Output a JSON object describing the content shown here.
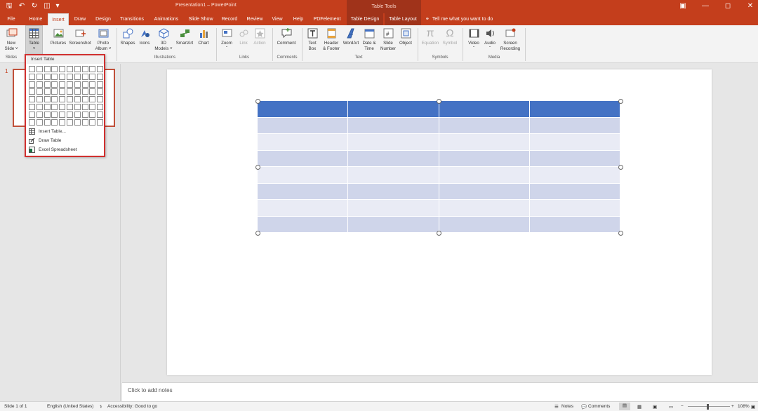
{
  "title_bar": {
    "title": "Presentation1  –  PowerPoint",
    "context_label": "Table Tools",
    "qat_icons": [
      "save-icon",
      "undo-icon",
      "redo-icon",
      "start-from-beginning-icon"
    ]
  },
  "tabs": [
    "File",
    "Home",
    "Insert",
    "Draw",
    "Design",
    "Transitions",
    "Animations",
    "Slide Show",
    "Record",
    "Review",
    "View",
    "Help",
    "PDFelement",
    "Table Design",
    "Table Layout"
  ],
  "active_tab": "Insert",
  "tell_me": "Tell me what you want to do",
  "ribbon": {
    "new_slide": [
      "New",
      "Slide ˅"
    ],
    "table": [
      "Table",
      "˅"
    ],
    "pictures": "Pictures",
    "screenshot": "Screenshot",
    "photo_album": [
      "Photo",
      "Album ˅"
    ],
    "shapes": "Shapes",
    "icons": "Icons",
    "models_3d": [
      "3D",
      "Models ˅"
    ],
    "smartart": "SmartArt",
    "chart": "Chart",
    "zoom": "Zoom",
    "link": "Link",
    "action": "Action",
    "comment": "Comment",
    "text_box": [
      "Text",
      "Box"
    ],
    "header_footer": [
      "Header",
      "& Footer"
    ],
    "wordart": "WordArt",
    "date_time": [
      "Date &",
      "Time"
    ],
    "slide_number": [
      "Slide",
      "Number"
    ],
    "object": "Object",
    "equation": "Equation",
    "symbol": "Symbol",
    "video": "Video",
    "audio": "Audio",
    "screen_recording": [
      "Screen",
      "Recording"
    ],
    "groups": {
      "slides": "Slides",
      "illustrations": "Illustrations",
      "links": "Links",
      "comments": "Comments",
      "text": "Text",
      "symbols": "Symbols",
      "media": "Media"
    }
  },
  "dropdown": {
    "title": "Insert Table",
    "grid_columns": 10,
    "grid_rows": 8,
    "items": [
      "Insert Table...",
      "Draw Table",
      "Excel Spreadsheet"
    ]
  },
  "thumbnail_number": "1",
  "slide_table": {
    "rows": 8,
    "columns": 4,
    "header_color": "#4472c4",
    "band_color_1": "#cfd5ea",
    "band_color_2": "#e9ebf5"
  },
  "notes_placeholder": "Click to add notes",
  "status": {
    "slide": "Slide 1 of 1",
    "language": "English (United States)",
    "accessibility": "Accessibility: Good to go",
    "notes": "Notes",
    "comments": "Comments",
    "zoom": "108%"
  },
  "colors": {
    "accent": "#c43e1c",
    "highlight": "#d0302f"
  }
}
